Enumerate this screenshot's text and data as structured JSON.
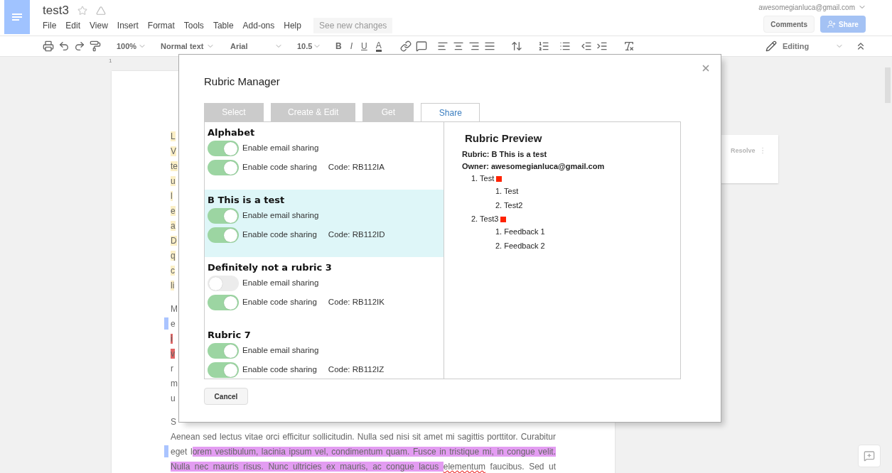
{
  "app": {
    "title": "test3",
    "menu": [
      "File",
      "Edit",
      "View",
      "Insert",
      "Format",
      "Tools",
      "Table",
      "Add-ons",
      "Help"
    ],
    "see_changes": "See new changes",
    "account": "awesomegianluca@gmail.com",
    "comments_button": "Comments",
    "share_button": "Share"
  },
  "toolbar": {
    "zoom": "100%",
    "style": "Normal text",
    "font": "Arial",
    "size": "10.5",
    "bold": "B",
    "italic": "I",
    "underline": "U",
    "text_color": "A",
    "mode": "Editing"
  },
  "ruler": {
    "mark": "1"
  },
  "document": {
    "paragraphs": [
      {
        "lines": [
          {
            "kind": "cut",
            "comment": false,
            "segments": [
              {
                "text": "L",
                "color": "#fbefc5"
              }
            ]
          },
          {
            "kind": "cut",
            "comment": false,
            "segments": [
              {
                "text": "V",
                "color": "#fbefc5"
              }
            ]
          },
          {
            "kind": "cut",
            "comment": false,
            "segments": [
              {
                "text": "te",
                "color": "#fbefc5"
              }
            ]
          },
          {
            "kind": "cut",
            "comment": false,
            "segments": [
              {
                "text": "u",
                "color": "#fbefc5"
              }
            ]
          },
          {
            "kind": "cut",
            "comment": false,
            "segments": [
              {
                "text": "l",
                "color": "#fbefc5"
              }
            ]
          },
          {
            "kind": "cut",
            "comment": false,
            "segments": [
              {
                "text": "e",
                "color": "#fbefc5"
              }
            ]
          },
          {
            "kind": "cut",
            "comment": false,
            "segments": [
              {
                "text": "a",
                "color": "#fbefc5"
              }
            ]
          },
          {
            "kind": "cut",
            "comment": false,
            "segments": [
              {
                "text": "D",
                "color": "#fbefc5"
              }
            ]
          },
          {
            "kind": "cut",
            "comment": false,
            "segments": [
              {
                "text": "q",
                "color": "#fbefc5"
              }
            ]
          },
          {
            "kind": "cut",
            "comment": false,
            "segments": [
              {
                "text": "c",
                "color": "#fbefc5"
              }
            ]
          },
          {
            "kind": "cut",
            "comment": false,
            "segments": [
              {
                "text": "li",
                "color": "#fbefc5"
              }
            ]
          }
        ]
      },
      {
        "lines": [
          {
            "kind": "cut",
            "comment": false,
            "segments": [
              {
                "text": "M"
              }
            ]
          },
          {
            "kind": "cut",
            "comment": true,
            "segments": [
              {
                "text": "e"
              }
            ]
          },
          {
            "kind": "cut",
            "comment": false,
            "segments": [
              {
                "text": "i",
                "color": "#e06666"
              }
            ]
          },
          {
            "kind": "cut",
            "comment": false,
            "segments": [
              {
                "text": "v",
                "color": "#e06666"
              }
            ]
          },
          {
            "kind": "cut",
            "comment": false,
            "segments": [
              {
                "text": "r"
              }
            ]
          },
          {
            "kind": "cut",
            "comment": false,
            "segments": [
              {
                "text": "m"
              }
            ]
          },
          {
            "kind": "cut",
            "comment": false,
            "segments": [
              {
                "text": "u"
              }
            ]
          }
        ]
      },
      {
        "lines": [
          {
            "kind": "cut",
            "comment": false,
            "segments": [
              {
                "text": "S"
              }
            ]
          },
          {
            "kind": "full",
            "comment": false,
            "segments": [
              {
                "text": "Aenean sed lectus vitae orci efficitur sollicitudin. Nulla sed nisi sit amet mi sagittis porttitor. Curabitur"
              }
            ]
          },
          {
            "kind": "full",
            "comment": true,
            "segments": [
              {
                "text": "eget l"
              },
              {
                "text": "orem vestibulum, lacinia ipsum vel, condimentum quam. Fusce in tristique mi, in congue velit.",
                "color": "#e39cf2"
              }
            ]
          },
          {
            "kind": "full",
            "comment": false,
            "segments": [
              {
                "text": "Nulla nec mauris risus. Nunc ultricies ex mauris, ac congue lacus  ",
                "color": "#e39cf2"
              },
              {
                "text": "elementum",
                "misspelled": true
              },
              {
                "text": " faucibus. Sed ut",
                "misspelled": false
              }
            ]
          }
        ]
      }
    ]
  },
  "comment_card": {
    "action": "Resolve"
  },
  "dialog": {
    "title": "Rubric Manager",
    "tabs": [
      {
        "label": "Select",
        "selected": false
      },
      {
        "label": "Create & Edit",
        "selected": false
      },
      {
        "label": "Get",
        "selected": false
      },
      {
        "label": "Share",
        "selected": true
      }
    ],
    "rubrics": [
      {
        "name": "Alphabet",
        "selected": false,
        "email_sharing": {
          "label": "Enable email sharing",
          "on": true
        },
        "code_sharing": {
          "label": "Enable code sharing",
          "on": true
        },
        "code": "Code: RB112IA"
      },
      {
        "name": "B This is a test",
        "selected": true,
        "email_sharing": {
          "label": "Enable email sharing",
          "on": true
        },
        "code_sharing": {
          "label": "Enable code sharing",
          "on": true
        },
        "code": "Code: RB112ID"
      },
      {
        "name": "Definitely not a rubric 3",
        "selected": false,
        "email_sharing": {
          "label": "Enable email sharing",
          "on": false
        },
        "code_sharing": {
          "label": "Enable code sharing",
          "on": true
        },
        "code": "Code: RB112IK"
      },
      {
        "name": "Rubric 7",
        "selected": false,
        "email_sharing": {
          "label": "Enable email sharing",
          "on": true
        },
        "code_sharing": {
          "label": "Enable code sharing",
          "on": true
        },
        "code": "Code: RB112IZ"
      }
    ],
    "preview": {
      "title": "Rubric Preview",
      "rubric": "Rubric: B This is a test",
      "owner": "Owner: awesomegianluca@gmail.com",
      "criteria": [
        {
          "label": "1. Test",
          "color": "#ff2200",
          "children": [
            {
              "label": "1. Test"
            },
            {
              "label": "2. Test2"
            }
          ]
        },
        {
          "label": "2. Test3",
          "color": "#ff2200",
          "children": [
            {
              "label": "1. Feedback 1"
            },
            {
              "label": "2. Feedback 2"
            }
          ]
        }
      ]
    },
    "cancel": "Cancel"
  }
}
